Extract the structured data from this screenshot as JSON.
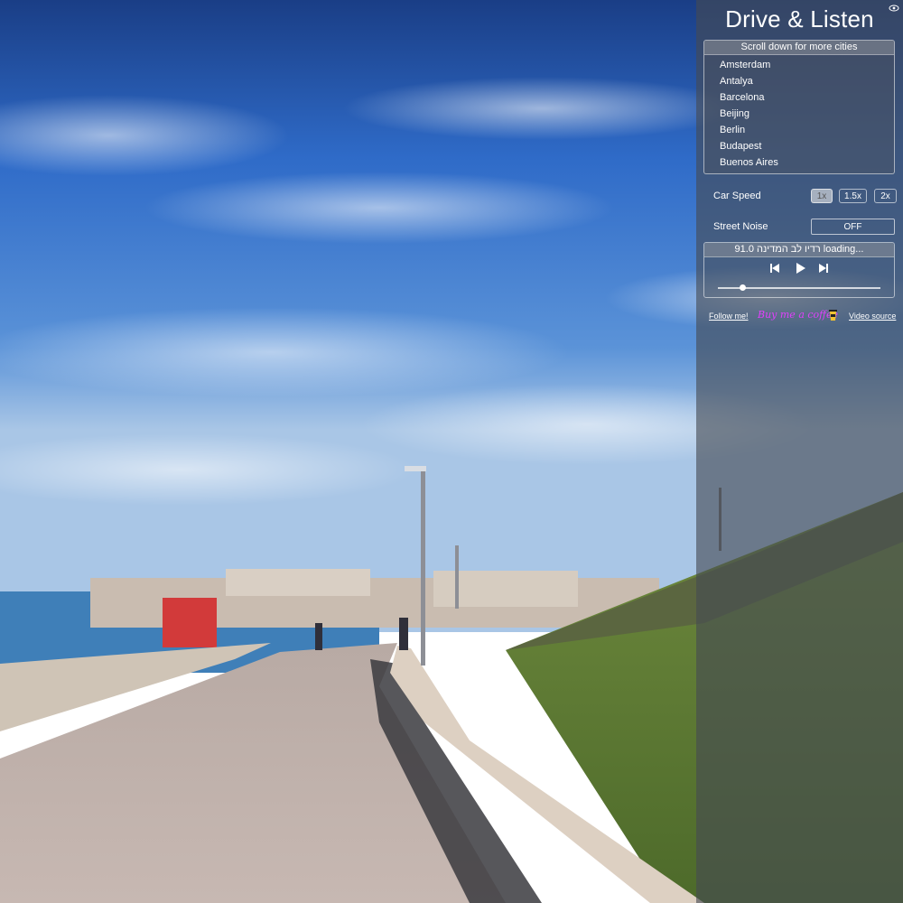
{
  "app": {
    "title": "Drive & Listen"
  },
  "cities": {
    "header": "Scroll down for more cities",
    "items": [
      "Amsterdam",
      "Antalya",
      "Barcelona",
      "Beijing",
      "Berlin",
      "Budapest",
      "Buenos Aires"
    ]
  },
  "speed": {
    "label": "Car Speed",
    "options": [
      "1x",
      "1.5x",
      "2x"
    ],
    "selected": "1x"
  },
  "noise": {
    "label": "Street Noise",
    "state": "OFF"
  },
  "radio": {
    "station": "91.0 רדיו לב המדינה loading...",
    "volume": 0.15
  },
  "footer": {
    "follow": "Follow me!",
    "coffee": "Buy me a coffee",
    "source": "Video source"
  },
  "icons": [
    "eye-icon",
    "previous-track-icon",
    "play-icon",
    "next-track-icon",
    "coffee-cup-icon"
  ],
  "colors": {
    "panel": "#464a52",
    "coffee_text": "#e040fb"
  }
}
